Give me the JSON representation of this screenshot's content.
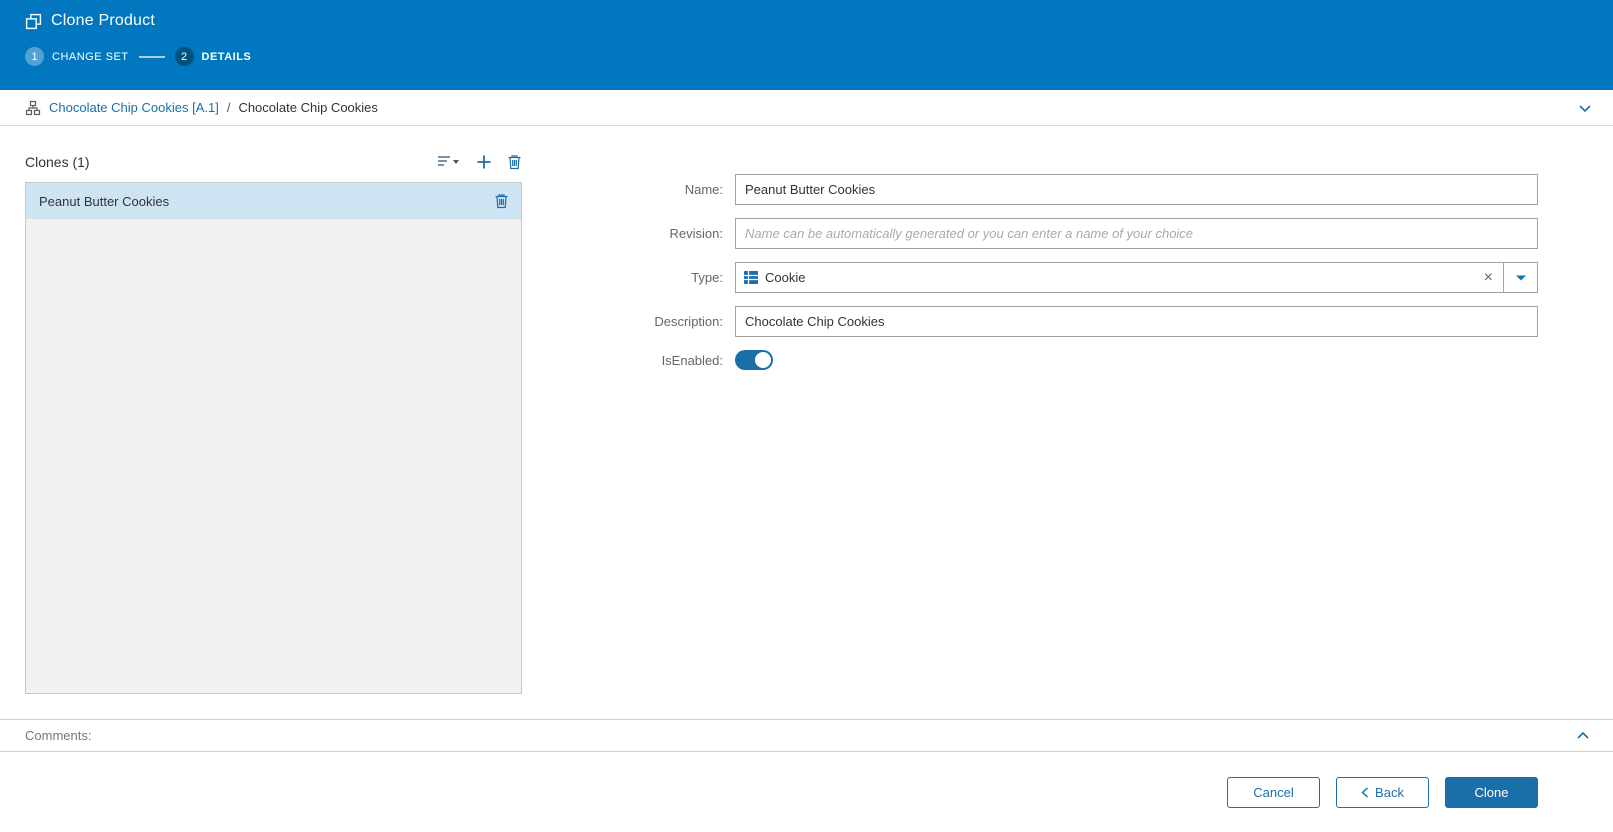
{
  "header": {
    "title": "Clone Product",
    "steps": [
      {
        "number": "1",
        "label": "CHANGE SET"
      },
      {
        "number": "2",
        "label": "DETAILS"
      }
    ]
  },
  "breadcrumb": {
    "link": "Chocolate Chip Cookies [A.1]",
    "separator": "/",
    "current": "Chocolate Chip Cookies"
  },
  "clones_panel": {
    "title": "Clones (1)",
    "items": [
      {
        "name": "Peanut Butter Cookies"
      }
    ]
  },
  "form": {
    "name": {
      "label": "Name:",
      "value": "Peanut Butter Cookies"
    },
    "revision": {
      "label": "Revision:",
      "placeholder": "Name can be automatically generated or you can enter a name of your choice"
    },
    "type": {
      "label": "Type:",
      "value": "Cookie"
    },
    "description": {
      "label": "Description:",
      "value": "Chocolate Chip Cookies"
    },
    "is_enabled": {
      "label": "IsEnabled:",
      "state": "on"
    }
  },
  "comments": {
    "label": "Comments:"
  },
  "footer": {
    "cancel_label": "Cancel",
    "back_label": "Back",
    "clone_label": "Clone"
  },
  "icons": {
    "clone": "clone-icon",
    "clear": "×"
  },
  "colors": {
    "header_bg": "#0077be",
    "accent": "#1b6fa8",
    "step_active_bg": "#00527e",
    "selected_item_bg": "#cfe4f3",
    "list_bg": "#f1f1f1"
  }
}
